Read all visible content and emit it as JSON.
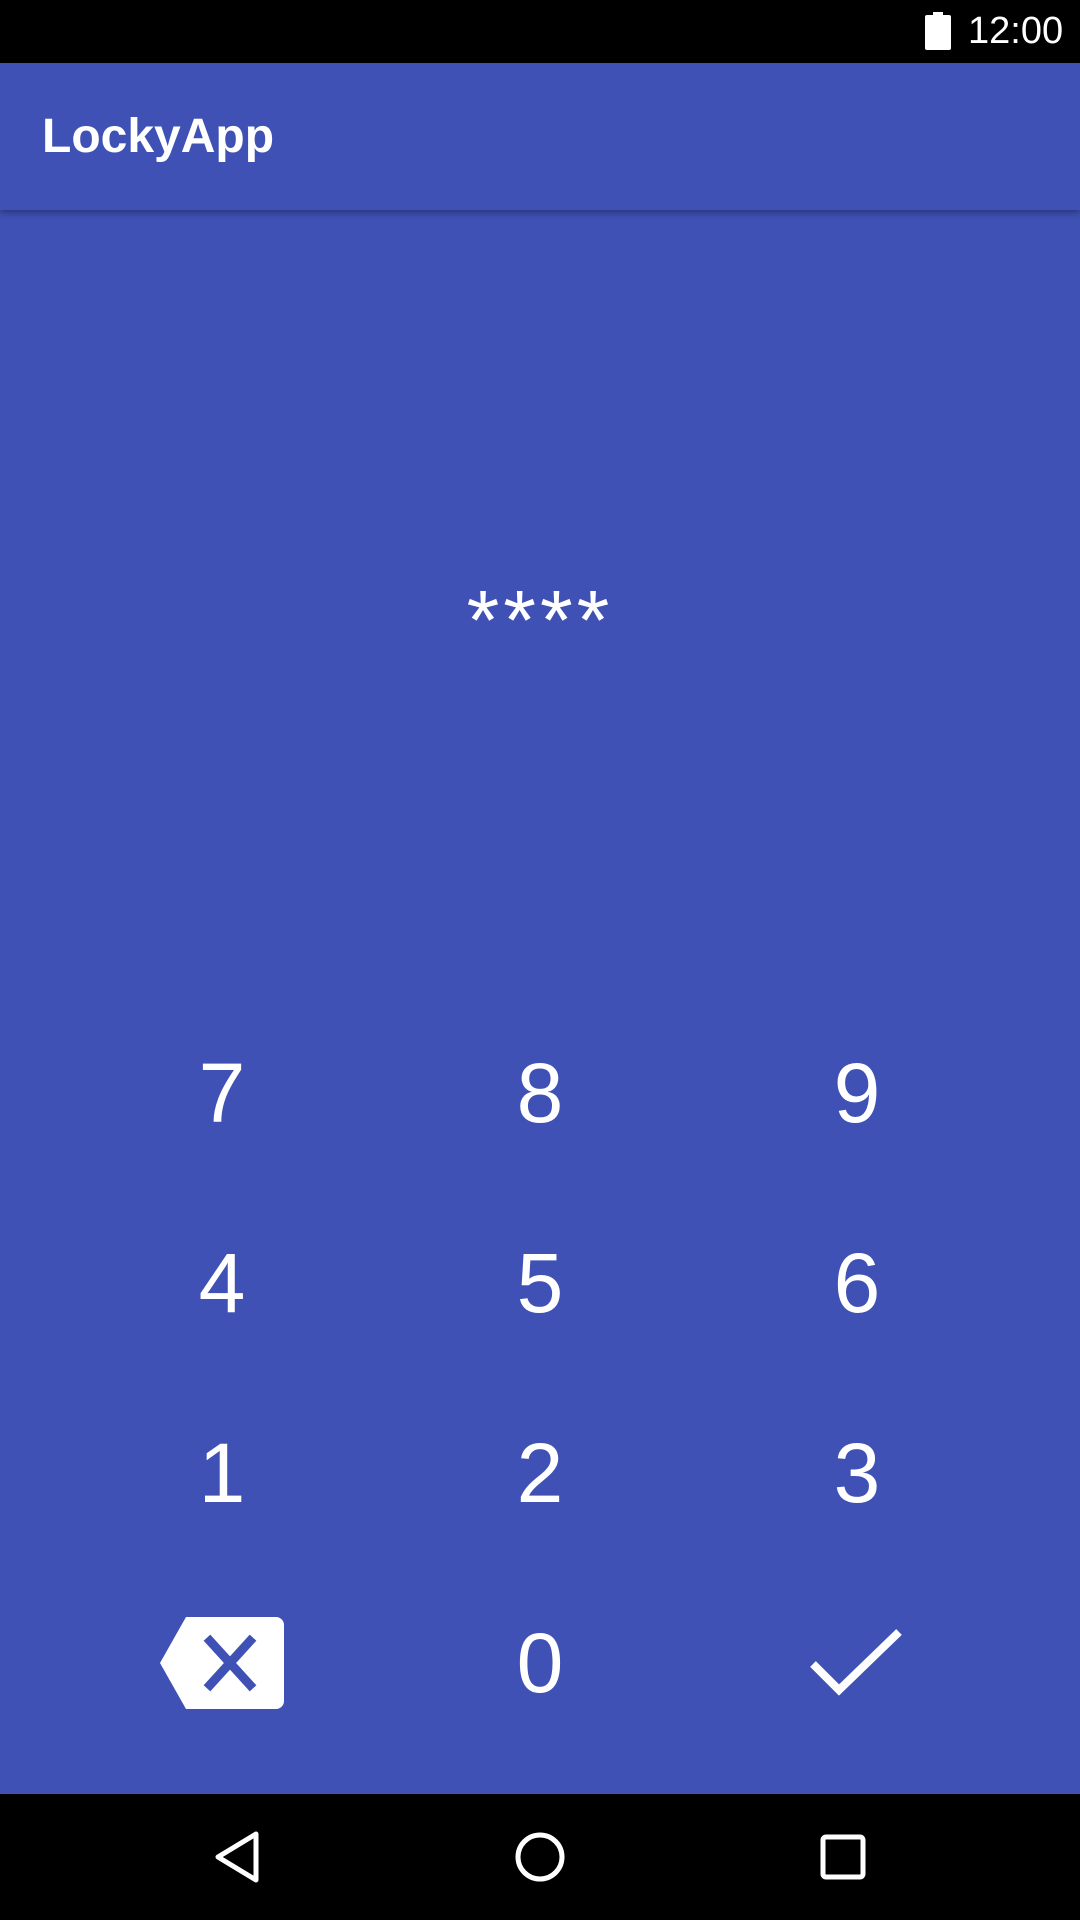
{
  "status_bar": {
    "time": "12:00",
    "battery_icon": "battery-full-icon"
  },
  "app_bar": {
    "title": "LockyApp"
  },
  "pin": {
    "masked_value": "****"
  },
  "keypad": {
    "rows": [
      [
        "7",
        "8",
        "9"
      ],
      [
        "4",
        "5",
        "6"
      ],
      [
        "1",
        "2",
        "3"
      ]
    ],
    "zero": "0",
    "backspace_icon": "backspace-icon",
    "confirm_icon": "check-icon"
  },
  "nav_bar": {
    "back_icon": "back-triangle-icon",
    "home_icon": "home-circle-icon",
    "recents_icon": "recents-square-icon"
  },
  "colors": {
    "primary": "#3F51B5",
    "status_bar": "#000000",
    "text": "#FFFFFF"
  }
}
